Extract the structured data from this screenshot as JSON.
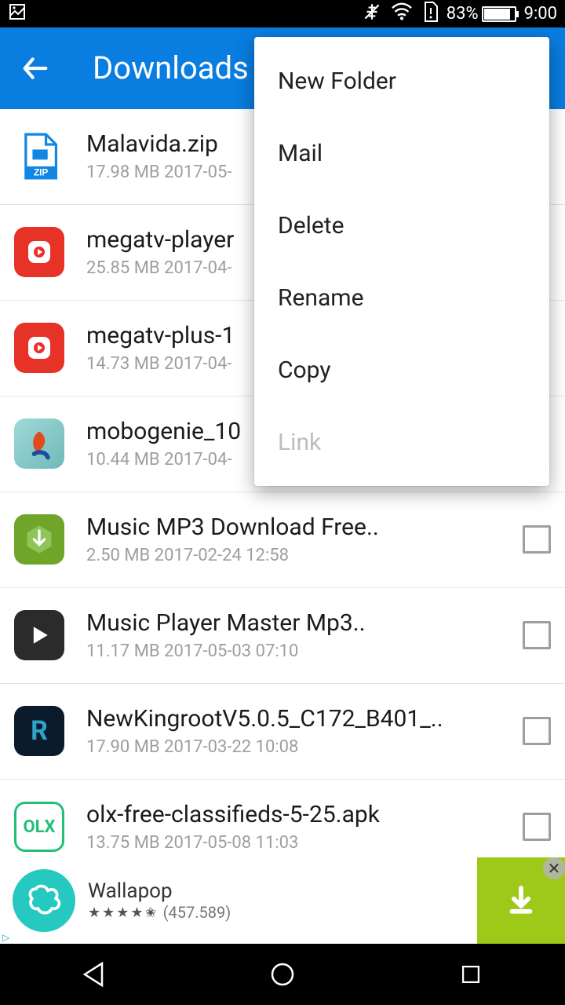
{
  "status": {
    "battery_pct": "83%",
    "time": "9:00"
  },
  "appbar": {
    "title": "Downloads"
  },
  "files": [
    {
      "name": "Malavida.zip",
      "meta": "17.98 MB  2017-05-"
    },
    {
      "name": "megatv-player",
      "meta": "25.85 MB  2017-04-"
    },
    {
      "name": "megatv-plus-1",
      "meta": "14.73 MB  2017-04-"
    },
    {
      "name": "mobogenie_10",
      "meta": "10.44 MB  2017-04-"
    },
    {
      "name": "Music MP3 Download Free..",
      "meta": "2.50 MB  2017-02-24 12:58"
    },
    {
      "name": "Music Player Master Mp3..",
      "meta": "11.17 MB  2017-05-03 07:10"
    },
    {
      "name": "NewKingrootV5.0.5_C172_B401_..",
      "meta": "17.90 MB  2017-03-22 10:08"
    },
    {
      "name": "olx-free-classifieds-5-25.apk",
      "meta": "13.75 MB  2017-05-08 11:03"
    }
  ],
  "menu": {
    "items": [
      "New Folder",
      "Mail",
      "Delete",
      "Rename",
      "Copy",
      "Link"
    ]
  },
  "ad": {
    "title": "Wallapop",
    "count": "(457.589)"
  }
}
